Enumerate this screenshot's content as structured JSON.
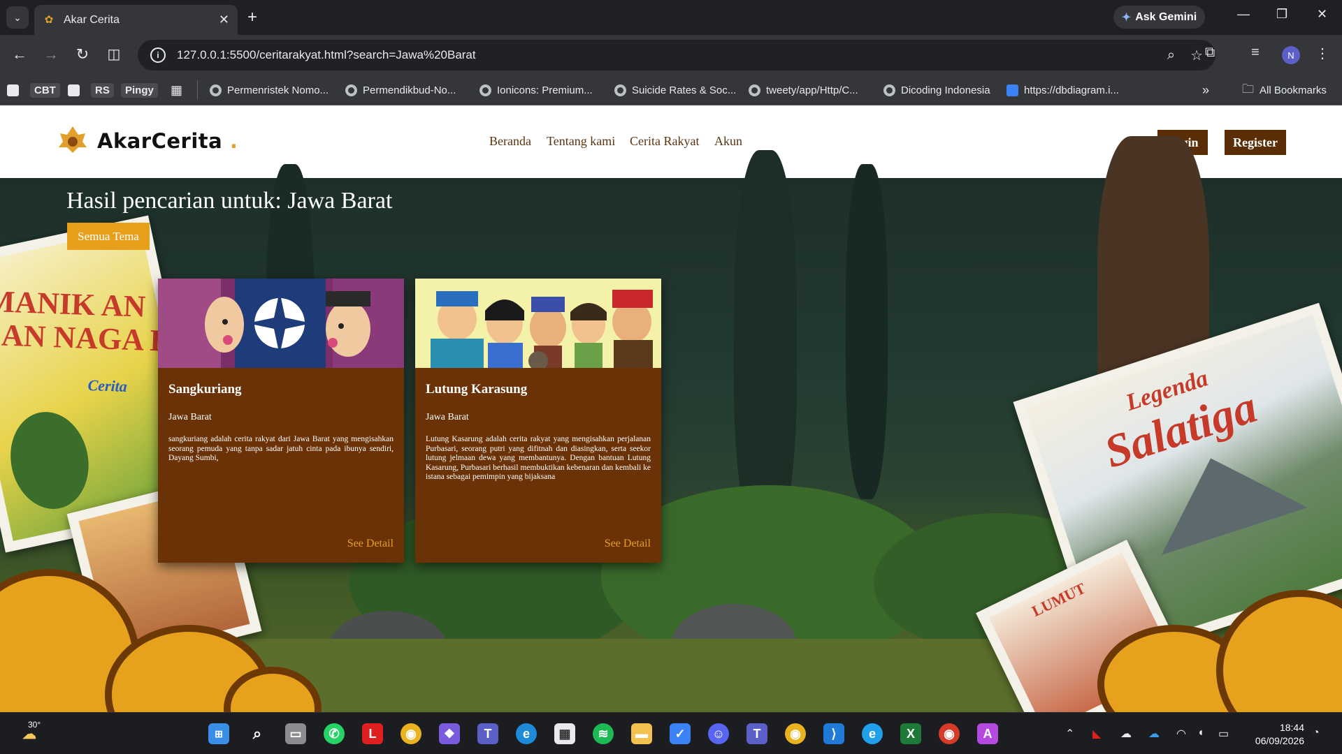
{
  "browser": {
    "tab_title": "Akar Cerita",
    "url": "127.0.0.1:5500/ceritarakyat.html?search=Jawa%20Barat",
    "gemini_label": "Ask Gemini",
    "avatar_initial": "N",
    "bookmarks": [
      {
        "label": "CBT"
      },
      {
        "label": "RS"
      },
      {
        "label": "Pingy"
      },
      {
        "label": "Permenristek Nomo..."
      },
      {
        "label": "Permendikbud-No..."
      },
      {
        "label": "Ionicons: Premium..."
      },
      {
        "label": "Suicide Rates & Soc..."
      },
      {
        "label": "tweety/app/Http/C..."
      },
      {
        "label": "Dicoding Indonesia"
      },
      {
        "label": "https://dbdiagram.i..."
      }
    ],
    "all_bookmarks_label": "All Bookmarks"
  },
  "site": {
    "logo_text": "AkarCerita",
    "logo_dot": ".",
    "nav": [
      "Beranda",
      "Tentang kami",
      "Cerita Rakyat",
      "Akun"
    ],
    "login_label": "Login",
    "register_label": "Register"
  },
  "search": {
    "title": "Hasil pencarian untuk: Jawa Barat",
    "chip_label": "Semua Tema"
  },
  "cards": [
    {
      "title": "Sangkuriang",
      "region": "Jawa Barat",
      "description": "sangkuriang adalah cerita rakyat dari Jawa Barat yang mengisahkan seorang pemuda yang tanpa sadar jatuh cinta pada ibunya sendiri, Dayang Sumbi,",
      "detail_label": "See Detail"
    },
    {
      "title": "Lutung Karasung",
      "region": "Jawa Barat",
      "description": "Lutung Kasarung adalah cerita rakyat yang mengisahkan perjalanan Purbasari, seorang putri yang difitnah dan diasingkan, serta seekor lutung jelmaan dewa yang membantunya. Dengan bantuan Lutung Kasarung, Purbasari berhasil membuktikan kebenaran dan kembali ke istana sebagai pemimpin yang bijaksana",
      "detail_label": "See Detail"
    }
  ],
  "posters": {
    "left_title_1": "MANIK AN",
    "left_title_2": "DAN NAGA B",
    "left_sub": "Cerita",
    "right_title_1": "Legenda",
    "right_title_2": "Salatiga",
    "bottom_right": "LUMUT"
  },
  "taskbar": {
    "temperature": "30°",
    "time": "18:44",
    "date": "06/09/2026"
  },
  "colors": {
    "brown": "#6a3206",
    "dark_brown": "#5a2d06",
    "gold": "#e8a01c"
  }
}
